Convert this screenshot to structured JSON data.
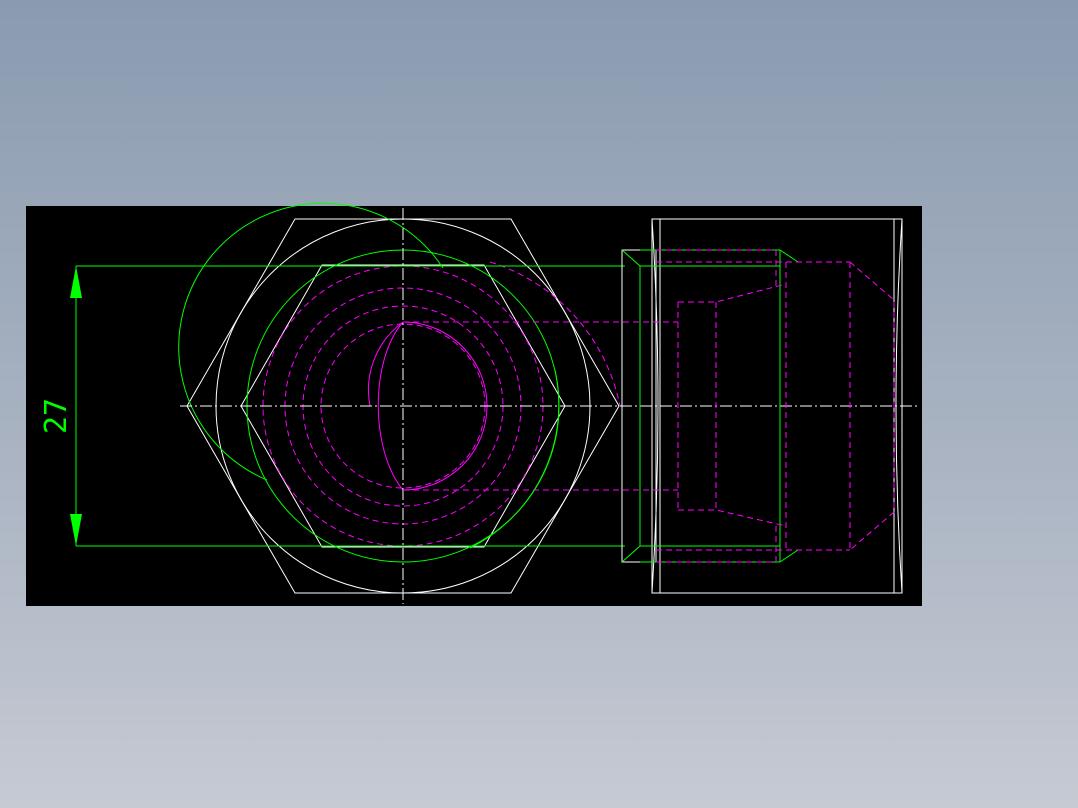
{
  "dimension": {
    "value": "27"
  },
  "faint_note": "",
  "colors": {
    "background_top": "#8a9bb0",
    "background_bottom": "#c6cad3",
    "canvas": "#000000",
    "outline": "#ffffff",
    "dimension": "#00ff00",
    "hidden": "#ff00ff"
  }
}
